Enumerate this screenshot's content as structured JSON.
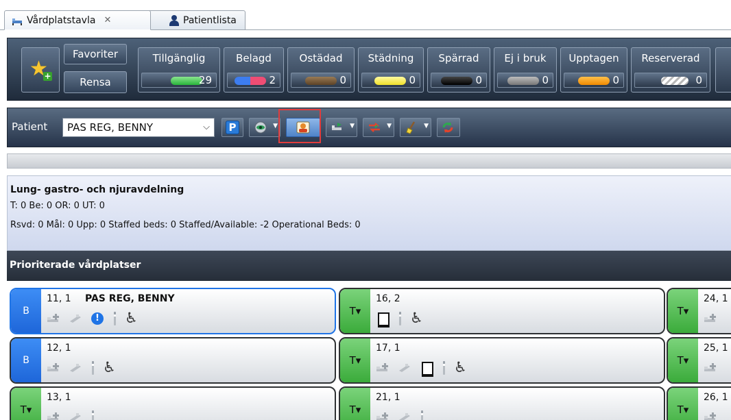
{
  "tabs": [
    {
      "label": "Vårdplatstavla",
      "active": true,
      "closable": true,
      "icon": "bed-board-icon"
    },
    {
      "label": "Patientlista",
      "active": false,
      "icon": "person-icon"
    }
  ],
  "statusbar": {
    "favorites_label": "Favoriter",
    "clear_label": "Rensa",
    "groups": [
      {
        "label": "Tillgänglig",
        "count": "29",
        "color": "#39c449"
      },
      {
        "label": "Belagd",
        "count": "2",
        "color": "#e8415a"
      },
      {
        "label": "Ostädad",
        "count": "0",
        "color": "#6a5238"
      },
      {
        "label": "Städning",
        "count": "0",
        "color": "#f4ef4b"
      },
      {
        "label": "Spärrad",
        "count": "0",
        "color": "#1a1a1a"
      },
      {
        "label": "Ej i bruk",
        "count": "0",
        "color": "#8a8a8a"
      },
      {
        "label": "Upptagen",
        "count": "0",
        "color": "#f59a12"
      },
      {
        "label": "Reserverad",
        "count": "0",
        "color": "#e8e8e8"
      }
    ]
  },
  "patientbar": {
    "label": "Patient",
    "selected_patient": "PAS REG, BENNY"
  },
  "unit": {
    "title": "Lung- gastro- och njuravdelning",
    "line1": "T: 0 Be: 0 OR: 0 UT: 0",
    "line2": "Rsvd: 0 Mål: 0 Upp: 0 Staffed beds: 0 Staffed/Available: -2 Operational Beds: 0"
  },
  "priority_header": "Prioriterade vårdplatser",
  "beds": [
    {
      "id": "11, 1",
      "state": "B",
      "patient": "PAS REG, BENNY",
      "icons": [
        "bed-plus-icon",
        "bed-icon",
        "alert-icon",
        "iv-icon",
        "wheelchair-icon"
      ]
    },
    {
      "id": "12, 1",
      "state": "B",
      "patient": "",
      "icons": [
        "bed-plus-icon",
        "bed-icon",
        "iv-icon",
        "wheelchair-icon"
      ]
    },
    {
      "id": "13, 1",
      "state": "T▾",
      "patient": "",
      "icons": [
        "bed-plus-icon",
        "bed-icon",
        "iv-icon"
      ]
    },
    {
      "id": "16, 2",
      "state": "T▾",
      "patient": "",
      "icons": [
        "isolation-icon",
        "iv-icon",
        "wheelchair-icon"
      ]
    },
    {
      "id": "17, 1",
      "state": "T▾",
      "patient": "",
      "icons": [
        "bed-plus-icon",
        "bed-icon",
        "isolation-icon",
        "iv-icon",
        "wheelchair-icon"
      ]
    },
    {
      "id": "21, 1",
      "state": "T▾",
      "patient": "",
      "icons": [
        "bed-plus-icon",
        "bed-icon",
        "iv-icon"
      ]
    },
    {
      "id": "24, 1",
      "state": "T▾",
      "patient": "",
      "icons": [
        "bed-plus-icon"
      ]
    },
    {
      "id": "25, 1",
      "state": "T▾",
      "patient": "",
      "icons": [
        "bed-plus-icon"
      ]
    },
    {
      "id": "26, 1",
      "state": "T▾",
      "patient": "",
      "icons": [
        "bed-plus-icon"
      ]
    }
  ]
}
